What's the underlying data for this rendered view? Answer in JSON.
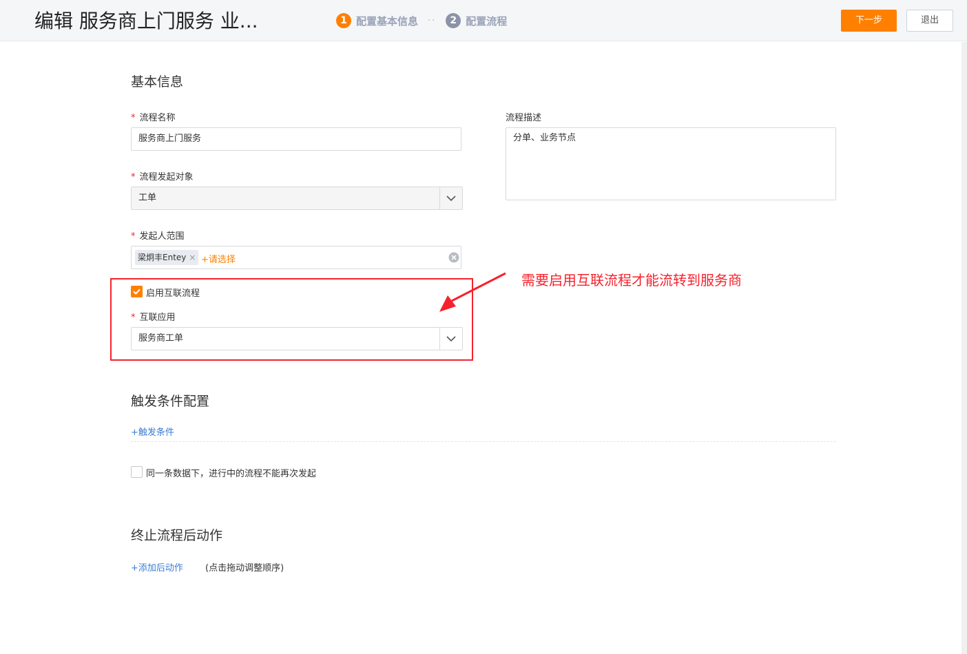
{
  "header": {
    "title": "编辑 服务商上门服务 业...",
    "steps": [
      {
        "num": "1",
        "label": "配置基本信息"
      },
      {
        "num": "2",
        "label": "配置流程"
      }
    ],
    "step_separator": "··",
    "next_label": "下一步",
    "exit_label": "退出"
  },
  "basic": {
    "section_title": "基本信息",
    "required_mark": "*",
    "name_label": "流程名称",
    "name_value": "服务商上门服务",
    "target_label": "流程发起对象",
    "target_value": "工单",
    "scope_label": "发起人范围",
    "scope_tag": "梁炯丰Entey",
    "scope_tag_remove": "×",
    "scope_add": "+请选择",
    "desc_label": "流程描述",
    "desc_value": "分单、业务节点",
    "interconnect_checkbox_label": "启用互联流程",
    "interconnect_app_label": "互联应用",
    "interconnect_app_value": "服务商工单"
  },
  "annotation": "需要启用互联流程才能流转到服务商",
  "trigger": {
    "section_title": "触发条件配置",
    "add_link": "+触发条件",
    "no_repeat_label": "同一条数据下，进行中的流程不能再次发起"
  },
  "terminate": {
    "section_title": "终止流程后动作",
    "add_link": "+添加后动作",
    "hint": "(点击拖动调整顺序)"
  },
  "colors": {
    "accent": "#ff8000",
    "annotation": "#f5222d",
    "link": "#3a7bd5"
  }
}
